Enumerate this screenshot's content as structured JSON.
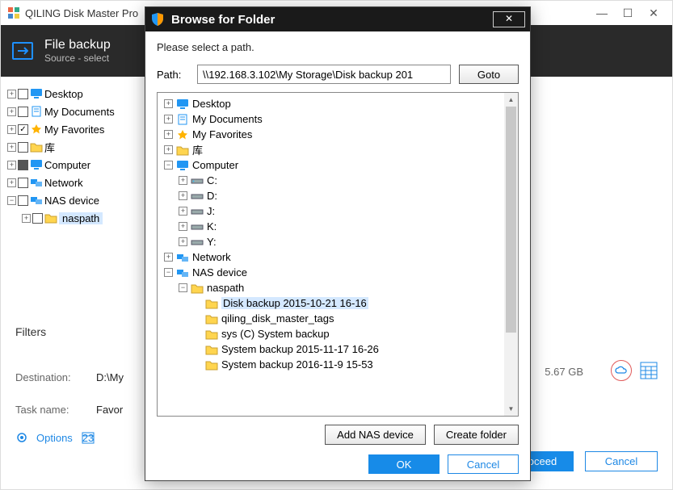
{
  "app": {
    "title": "QILING Disk Master Pro"
  },
  "header": {
    "title": "File backup",
    "subtitle": "Source - select"
  },
  "left_tree": {
    "items": [
      {
        "label": "Desktop"
      },
      {
        "label": "My Documents"
      },
      {
        "label": "My Favorites"
      },
      {
        "label": "库"
      },
      {
        "label": "Computer"
      },
      {
        "label": "Network"
      },
      {
        "label": "NAS device"
      }
    ],
    "naspath": "naspath"
  },
  "lower": {
    "filters": "Filters",
    "destination_label": "Destination:",
    "destination_value": "D:\\My",
    "taskname_label": "Task name:",
    "taskname_value": "Favor",
    "options": "Options",
    "gb": "5.67 GB",
    "proceed": "Proceed",
    "cancel": "Cancel"
  },
  "dialog": {
    "title": "Browse for Folder",
    "prompt": "Please select a path.",
    "path_label": "Path:",
    "path_value": "\\\\192.168.3.102\\My Storage\\Disk backup 201",
    "goto": "Goto",
    "add_nas": "Add NAS device",
    "create_folder": "Create folder",
    "ok": "OK",
    "cancel": "Cancel",
    "tree": {
      "desktop": "Desktop",
      "my_documents": "My Documents",
      "my_favorites": "My Favorites",
      "libraries": "库",
      "computer": "Computer",
      "drives": [
        "C:",
        "D:",
        "J:",
        "K:",
        "Y:"
      ],
      "network": "Network",
      "nas_device": "NAS device",
      "naspath": "naspath",
      "naspath_children": [
        "Disk backup 2015-10-21 16-16",
        "qiling_disk_master_tags",
        "sys (C) System backup",
        "System backup 2015-11-17 16-26",
        "System backup 2016-11-9 15-53"
      ]
    }
  },
  "colors": {
    "accent": "#178be8",
    "dark": "#1a1a1a"
  }
}
